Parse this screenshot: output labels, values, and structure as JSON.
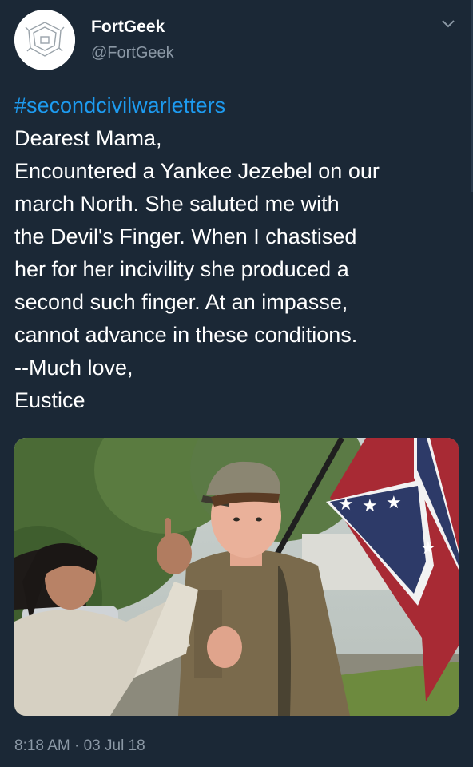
{
  "user": {
    "display_name": "FortGeek",
    "handle": "@FortGeek",
    "avatar_icon": "fort-outline-icon"
  },
  "menu": {
    "icon": "chevron-down-icon"
  },
  "tweet": {
    "hashtag": "#secondcivilwarletters",
    "lines": [
      "Dearest Mama,",
      "Encountered a Yankee Jezebel on our",
      "march North. She saluted me with",
      "the Devil's Finger. When I chastised",
      "her for her incivility she produced a",
      "second such finger. At an impasse,",
      "cannot advance in these conditions.",
      "--Much love,",
      "Eustice"
    ],
    "timestamp": "8:18 AM · 03 Jul 18"
  },
  "colors": {
    "background": "#1b2836",
    "link": "#1d9bf0",
    "secondary_text": "#8b98a5",
    "primary_text": "#ffffff"
  }
}
